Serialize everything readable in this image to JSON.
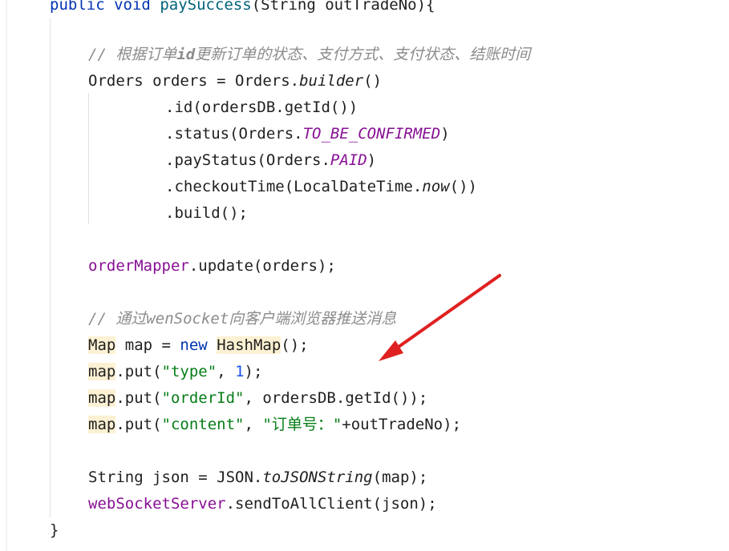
{
  "code": {
    "signature": {
      "kw1": "public",
      "kw2": "void",
      "method": "paySuccess",
      "rest": "(String outTradeNo){"
    },
    "comment1": {
      "prefix": "// ",
      "a": "根据订单",
      "b": "id",
      "c": "更新订单的状态、支付方式、支付状态、结账时间"
    },
    "orders_decl": {
      "a": "Orders orders = Orders.",
      "b": "builder",
      "c": "()"
    },
    "id_line": ".id(ordersDB.getId())",
    "status_line": {
      "a": ".status(Orders.",
      "b": "TO_BE_CONFIRMED",
      "c": ")"
    },
    "paystatus_line": {
      "a": ".payStatus(Orders.",
      "b": "PAID",
      "c": ")"
    },
    "checkout_line": {
      "a": ".checkoutTime(LocalDateTime.",
      "b": "now",
      "c": "())"
    },
    "build_line": ".build();",
    "update_line": {
      "field": "orderMapper",
      "rest": ".update(orders);"
    },
    "comment2": {
      "prefix": "// ",
      "a": "通过",
      "b": "wenSocket",
      "c": "向客户端浏览器推送消息"
    },
    "map_decl": {
      "type": "Map",
      "a": " map = ",
      "kw": "new",
      "sp": " ",
      "cls": "HashMap",
      "b": "();"
    },
    "put1": {
      "obj": "map",
      "a": ".put(",
      "key": "\"type\"",
      "b": ", ",
      "num": "1",
      "c": ");"
    },
    "put2": {
      "obj": "map",
      "a": ".put(",
      "key": "\"orderId\"",
      "b": ", ordersDB.getId());"
    },
    "put3": {
      "obj": "map",
      "a": ".put(",
      "key": "\"content\"",
      "b": ", ",
      "q1": "\"",
      "cn": "订单号：",
      "q2": "\"",
      "c": "+outTradeNo);"
    },
    "json_line": {
      "a": "String json = JSON.",
      "b": "toJSONString",
      "c": "(map);"
    },
    "ws_line": {
      "field": "webSocketServer",
      "rest": ".sendToAllClient(json);"
    },
    "close_brace": "}"
  },
  "colors": {
    "keyword": "#0033b3",
    "field": "#871094",
    "string": "#067d17",
    "number": "#1750eb",
    "comment": "#8c8c8c",
    "highlight": "#fcf1d3",
    "arrow": "#e02020"
  }
}
